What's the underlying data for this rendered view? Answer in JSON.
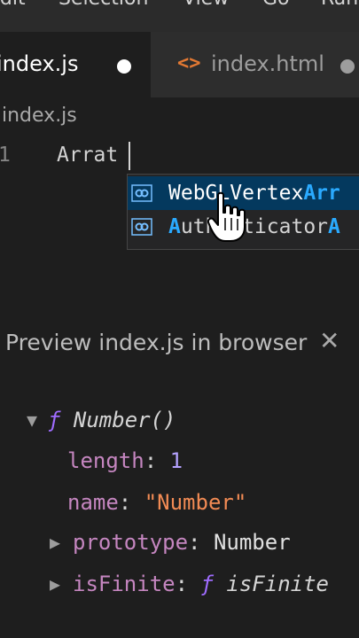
{
  "menubar": {
    "items": [
      "Edit",
      "Selection",
      "View",
      "Go",
      "Run"
    ]
  },
  "tabs": [
    {
      "label": "index.js",
      "state": "active",
      "dirty": true
    },
    {
      "label": "index.html",
      "state": "inactive",
      "dirty": true,
      "icon": "code-brackets-icon"
    }
  ],
  "breadcrumb": "index.js",
  "editor": {
    "line_number": "1",
    "code": "Arrat"
  },
  "suggestions": [
    {
      "prefix": "Web",
      "highlight1": "",
      "middle": "GLVertex",
      "highlight2": "Arr",
      "icon": "interface-icon",
      "selected": true
    },
    {
      "prefix": "",
      "highlight1": "A",
      "middle": "uthenticator",
      "highlight2": "A",
      "icon": "interface-icon",
      "selected": false
    }
  ],
  "preview": {
    "title": "Preview index.js in browser",
    "close_label": "✕"
  },
  "console": {
    "root": {
      "fn_keyword": "ƒ",
      "name": "Number()"
    },
    "length_key": "length",
    "length_val": "1",
    "name_key": "name",
    "name_val": "\"Number\"",
    "prototype_key": "prototype",
    "prototype_val": "Number",
    "isfinite_key": "isFinite",
    "isfinite_fn": "ƒ",
    "isfinite_val": "isFinite"
  },
  "colors": {
    "accent": "#2aaaff",
    "selection": "#04395e",
    "html_icon": "#e37933"
  }
}
